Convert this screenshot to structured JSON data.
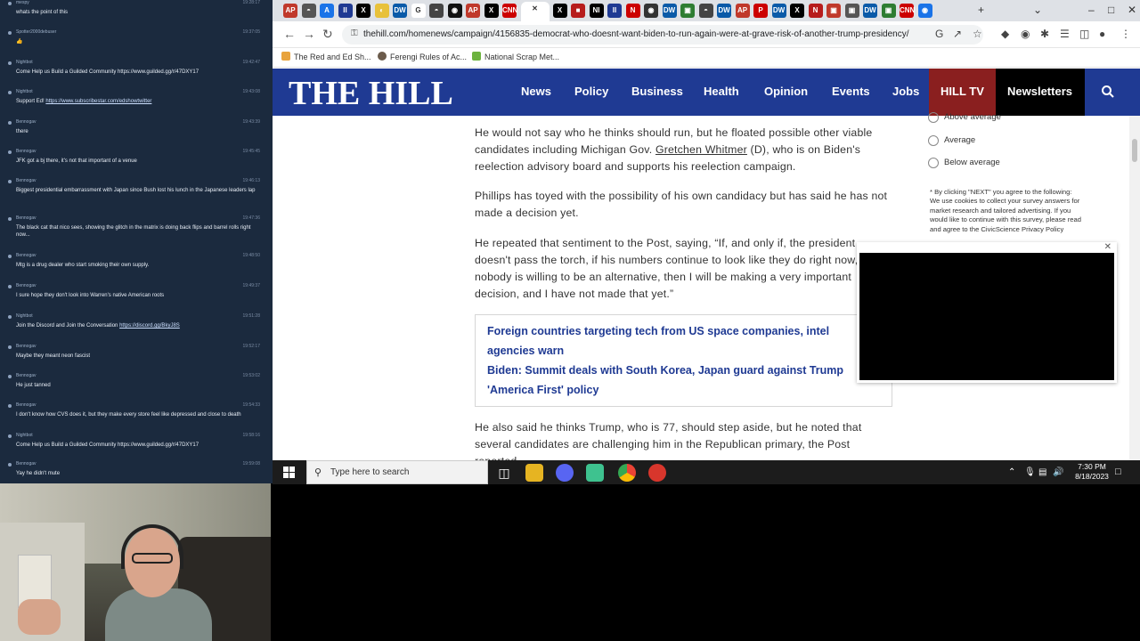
{
  "chat": {
    "messages": [
      {
        "user": "mespy",
        "time": "19:28:17",
        "text": "whats the point of this"
      },
      {
        "user": "Spotter2000debuser",
        "time": "19:37:05",
        "text": "👍"
      },
      {
        "user": "Nightbot",
        "time": "19:42:47",
        "text": "Come Help us Build a Guilded Community https://www.guilded.gg/r/47DXY17"
      },
      {
        "user": "Nightbot",
        "time": "19:43:08",
        "text": "Support Ed! https://www.subscribestar.com/edshowtwitter",
        "link": "https://www.subscribestar.com/edshowtwitter"
      },
      {
        "user": "Bennogav",
        "time": "19:43:39",
        "text": "there"
      },
      {
        "user": "Bennogav",
        "time": "19:45:45",
        "text": "JFK got a bj there, it's not that important of a venue"
      },
      {
        "user": "Bennogav",
        "time": "19:46:13",
        "text": "Biggest presidential embarrassment with Japan since Bush lost his lunch in the Japanese leaders lap"
      },
      {
        "user": "Bennogav",
        "time": "19:47:36",
        "text": "The black cat that nico sees, showing the glitch in the matrix is doing back flips and barrel rolls right now..."
      },
      {
        "user": "Bennogav",
        "time": "19:48:50",
        "text": "Mtg is a drug dealer who start smoking their own supply."
      },
      {
        "user": "Bennogav",
        "time": "19:49:37",
        "text": "I sure hope they don't look into Warren's native American roots"
      },
      {
        "user": "Nightbot",
        "time": "19:51:28",
        "text": "Join the Discord and Join the Conversation https://discord.gg/BkyJ8S",
        "link": "https://discord.gg/BkyJ8S"
      },
      {
        "user": "Bennogav",
        "time": "19:52:17",
        "text": "Maybe they meant neon fascist"
      },
      {
        "user": "Bennogav",
        "time": "19:53:02",
        "text": "He just tanned"
      },
      {
        "user": "Bennogav",
        "time": "19:54:33",
        "text": "I don't know how CVS does it, but they make every store feel like depressed and close to death"
      },
      {
        "user": "Nightbot",
        "time": "19:58:16",
        "text": "Come Help us Build a Guilded Community https://www.guilded.gg/r/47DXY17"
      },
      {
        "user": "Bennogav",
        "time": "19:59:08",
        "text": "Yay he didn't mute"
      }
    ]
  },
  "browser": {
    "url": "thehill.com/homenews/campaign/4156835-democrat-who-doesnt-want-biden-to-run-again-were-at-grave-risk-of-another-trump-presidency/",
    "bookmarks": [
      "The Red and Ed Sh...",
      "Ferengi Rules of Ac...",
      "National Scrap Met..."
    ],
    "tabs": [
      "AP",
      "◓",
      "A",
      "II",
      "X",
      "◐",
      "DW",
      "G",
      "◓",
      "◉",
      "AP",
      "X",
      "CNN",
      "✕",
      "X",
      "■",
      "NI",
      "II",
      "N",
      "◉",
      "DW",
      "▣",
      "◓",
      "DW",
      "AP",
      "P",
      "DW",
      "X",
      "N",
      "▣",
      "▣",
      "DW",
      "▣",
      "CNN",
      "◉"
    ]
  },
  "site": {
    "logo": "THE HILL",
    "nav": [
      "News",
      "Policy",
      "Business",
      "Health",
      "Opinion",
      "Events",
      "Jobs",
      "HILL TV",
      "Newsletters"
    ]
  },
  "article": {
    "p1_a": "He would not say who he thinks should run, but he floated possible other viable candidates including Michigan Gov. ",
    "p1_link": "Gretchen Whitmer",
    "p1_b": " (D), who is on Biden's reelection advisory board and supports his reelection campaign.",
    "p2": "Phillips has toyed with the possibility of his own candidacy but has said he has not made a decision yet.",
    "p3": "He repeated that sentiment to the Post, saying, “If, and only if, the president doesn't pass the torch, if his numbers continue to look like they do right now, and nobody is willing to be an alternative, then I will be making a very important decision, and I have not made that yet.”",
    "related": [
      "Foreign countries targeting tech from US space companies, intel agencies warn",
      "Biden: Summit deals with South Korea, Japan guard against Trump 'America First' policy"
    ],
    "p4": "He also said he thinks Trump, who is 77, should step aside, but he noted that several candidates are challenging him in the Republican primary, the Post reported."
  },
  "survey": {
    "options": [
      "Above average",
      "Average",
      "Below average"
    ],
    "disclaimer": "* By clicking \"NEXT\" you agree to the following: We use cookies to collect your survey answers for market research and tailored advertising. If you would like to continue with this survey, please read and agree to the CivicScience Privacy Policy"
  },
  "taskbar": {
    "search_placeholder": "Type here to search",
    "time": "7:30 PM",
    "date": "8/18/2023"
  },
  "colors": {
    "hill_blue": "#1f3a93",
    "hill_tv_red": "#8a1f1f",
    "chat_bg": "#1b2a3e"
  }
}
